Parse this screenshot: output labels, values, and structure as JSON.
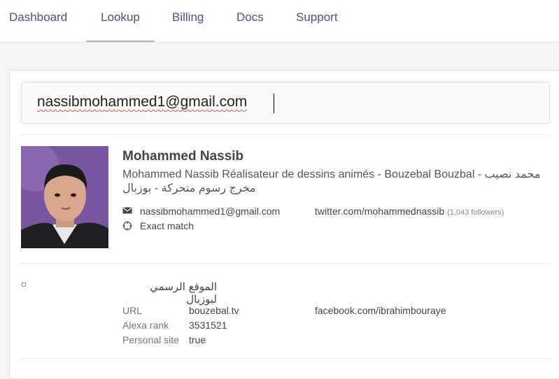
{
  "nav": {
    "tabs": [
      {
        "label": "Dashboard"
      },
      {
        "label": "Lookup"
      },
      {
        "label": "Billing"
      },
      {
        "label": "Docs"
      },
      {
        "label": "Support"
      }
    ],
    "active": "Lookup"
  },
  "search": {
    "value": "nassibmohammed1@gmail.com"
  },
  "person": {
    "name": "Mohammed Nassib",
    "bio": "Mohammed Nassib Réalisateur de dessins animés - Bouzebal Bouzbal - محمد نصيب مخرج رسوم متحركة - بوزبال",
    "email": "nassibmohammed1@gmail.com",
    "match": "Exact match",
    "twitter": "twitter.com/mohammednassib",
    "followers": "(1,043 followers)"
  },
  "company": {
    "title": "الموقع الرسمي لبوزبال",
    "rows": [
      {
        "label": "URL",
        "value": "bouzebal.tv"
      },
      {
        "label": "Alexa rank",
        "value": "3531521"
      },
      {
        "label": "Personal site",
        "value": "true"
      }
    ],
    "facebook": "facebook.com/ibrahimbouraye"
  },
  "icons": {
    "email": "envelope-icon",
    "match": "crosshair-icon"
  },
  "colors": {
    "accent": "#5b4a86",
    "active_underline": "#b3a6d9"
  }
}
